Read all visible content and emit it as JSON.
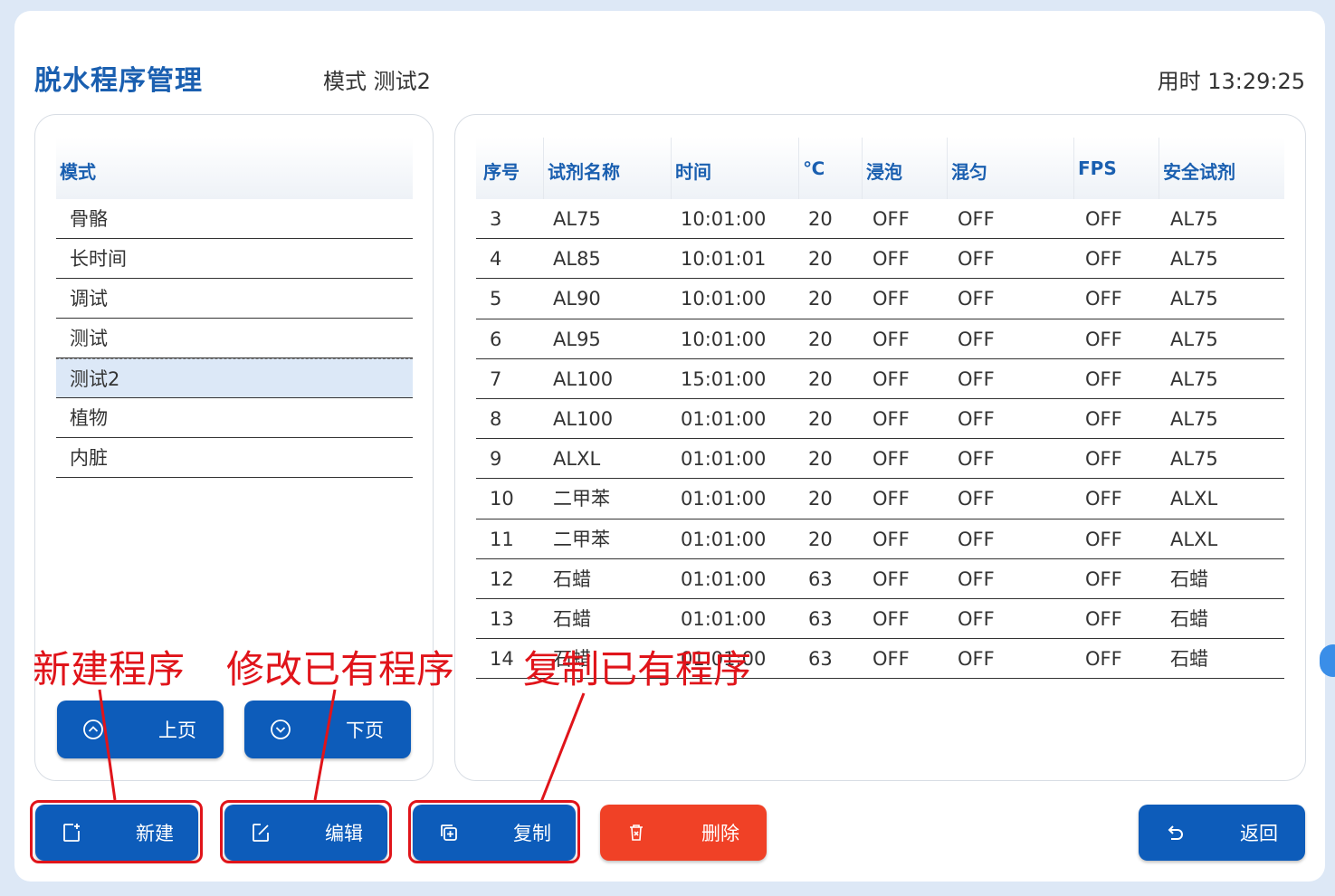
{
  "header": {
    "title": "脱水程序管理",
    "mode_text": "模式 测试2",
    "elapsed_text": "用时 13:29:25"
  },
  "mode_panel": {
    "header": "模式",
    "items": [
      "骨骼",
      "长时间",
      "调试",
      "测试",
      "测试2",
      "植物",
      "内脏"
    ],
    "selected_index": 4,
    "prev_page_label": "上页",
    "next_page_label": "下页"
  },
  "program_table": {
    "columns": [
      "序号",
      "试剂名称",
      "时间",
      "℃",
      "浸泡",
      "混匀",
      "FPS",
      "安全试剂"
    ],
    "rows": [
      [
        "3",
        "AL75",
        "10:01:00",
        "20",
        "OFF",
        "OFF",
        "OFF",
        "AL75"
      ],
      [
        "4",
        "AL85",
        "10:01:01",
        "20",
        "OFF",
        "OFF",
        "OFF",
        "AL75"
      ],
      [
        "5",
        "AL90",
        "10:01:00",
        "20",
        "OFF",
        "OFF",
        "OFF",
        "AL75"
      ],
      [
        "6",
        "AL95",
        "10:01:00",
        "20",
        "OFF",
        "OFF",
        "OFF",
        "AL75"
      ],
      [
        "7",
        "AL100",
        "15:01:00",
        "20",
        "OFF",
        "OFF",
        "OFF",
        "AL75"
      ],
      [
        "8",
        "AL100",
        "01:01:00",
        "20",
        "OFF",
        "OFF",
        "OFF",
        "AL75"
      ],
      [
        "9",
        "ALXL",
        "01:01:00",
        "20",
        "OFF",
        "OFF",
        "OFF",
        "AL75"
      ],
      [
        "10",
        "二甲苯",
        "01:01:00",
        "20",
        "OFF",
        "OFF",
        "OFF",
        "ALXL"
      ],
      [
        "11",
        "二甲苯",
        "01:01:00",
        "20",
        "OFF",
        "OFF",
        "OFF",
        "ALXL"
      ],
      [
        "12",
        "石蜡",
        "01:01:00",
        "63",
        "OFF",
        "OFF",
        "OFF",
        "石蜡"
      ],
      [
        "13",
        "石蜡",
        "01:01:00",
        "63",
        "OFF",
        "OFF",
        "OFF",
        "石蜡"
      ],
      [
        "14",
        "石蜡",
        "01:01:00",
        "63",
        "OFF",
        "OFF",
        "OFF",
        "石蜡"
      ]
    ]
  },
  "actions": {
    "new_label": "新建",
    "edit_label": "编辑",
    "copy_label": "复制",
    "delete_label": "删除",
    "back_label": "返回"
  },
  "annotations": {
    "new": "新建程序",
    "edit": "修改已有程序",
    "copy": "复制已有程序"
  },
  "colors": {
    "primary": "#0d5cba",
    "danger": "#f04126",
    "annotation": "#e0141a",
    "selected_row": "#dce8f7"
  },
  "icons": {
    "prev": "chevron-up-circle-icon",
    "next": "chevron-down-circle-icon",
    "new": "add-file-icon",
    "edit": "edit-icon",
    "copy": "copy-icon",
    "delete": "trash-icon",
    "back": "undo-arrow-icon"
  }
}
